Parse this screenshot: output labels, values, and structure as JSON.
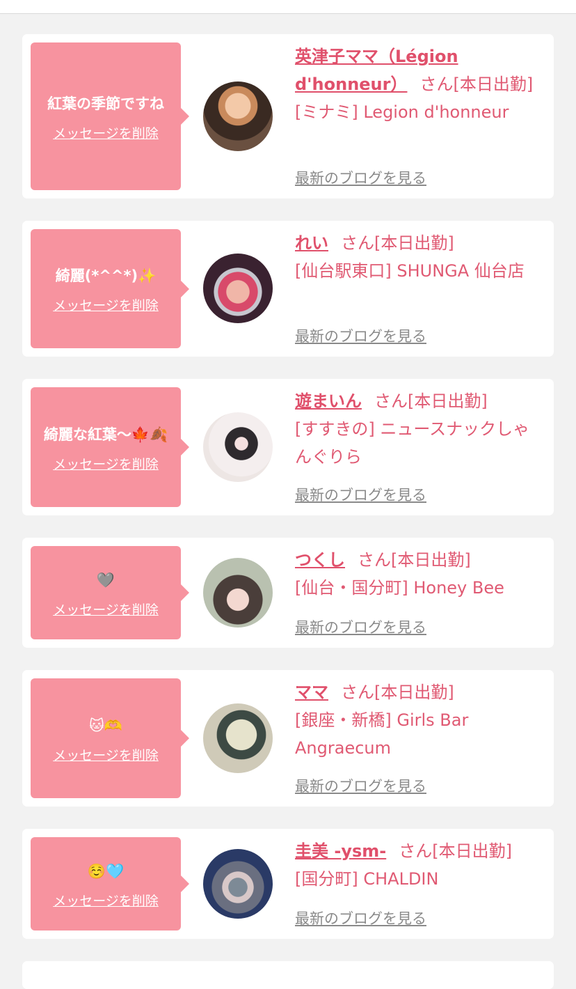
{
  "colors": {
    "accent": "#f7939f",
    "name": "#e0506b",
    "link": "#8a8a8a"
  },
  "cards": [
    {
      "message": "紅葉の季節ですね",
      "delete_label": "メッセージを削除",
      "name": "英津子ママ（Légion d'honneur）",
      "san": "さん[本日出勤]",
      "shop": "[ミナミ] Legion d'honneur",
      "blog_label": "最新のブログを見る"
    },
    {
      "message": "綺麗(*^^*)✨",
      "delete_label": "メッセージを削除",
      "name": "れい",
      "san": "さん[本日出勤]",
      "shop": "[仙台駅東口] SHUNGA 仙台店",
      "blog_label": "最新のブログを見る"
    },
    {
      "message": "綺麗な紅葉〜🍁🍂",
      "delete_label": "メッセージを削除",
      "name": "遊まいん",
      "san": "さん[本日出勤]",
      "shop": "[すすきの] ニュースナックしゃんぐりら",
      "blog_label": "最新のブログを見る"
    },
    {
      "message": "🩶",
      "delete_label": "メッセージを削除",
      "name": "つくし",
      "san": "さん[本日出勤]",
      "shop": "[仙台・国分町] Honey Bee",
      "blog_label": "最新のブログを見る"
    },
    {
      "message": "🐱🫶",
      "delete_label": "メッセージを削除",
      "name": "ママ",
      "san": "さん[本日出勤]",
      "shop": "[銀座・新橋] Girls Bar Angraecum",
      "blog_label": "最新のブログを見る"
    },
    {
      "message": "☺️🩵",
      "delete_label": "メッセージを削除",
      "name": "圭美 -ysm-",
      "san": "さん[本日出勤]",
      "shop": "[国分町] CHALDIN",
      "blog_label": "最新のブログを見る"
    }
  ]
}
